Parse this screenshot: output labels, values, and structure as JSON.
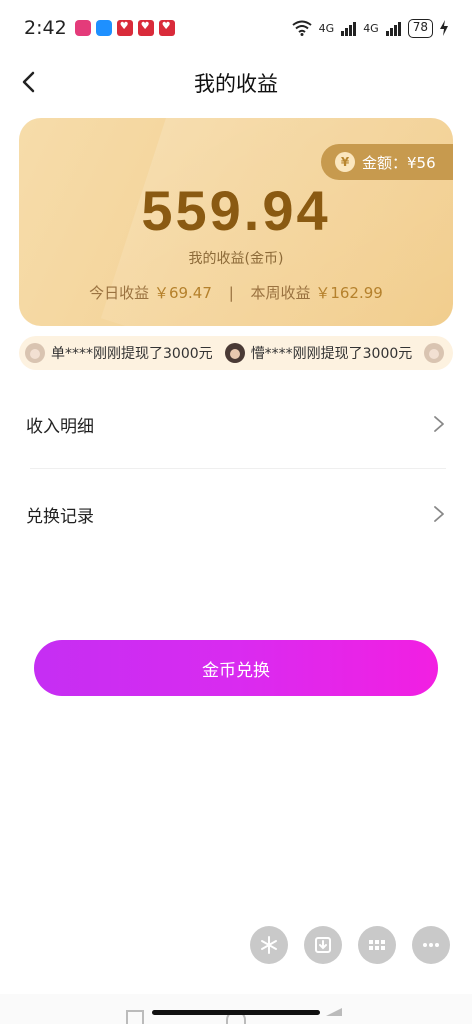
{
  "status_bar": {
    "time": "2:42",
    "network_1": "4G",
    "network_2": "4G",
    "battery": "78"
  },
  "header": {
    "title": "我的收益"
  },
  "card": {
    "amount_label": "金额：¥56",
    "total": "559.94",
    "total_label": "我的收益(金币)",
    "today_label": "今日收益",
    "today_value": "￥69.47",
    "separator": "|",
    "week_label": "本周收益",
    "week_value": "￥162.99"
  },
  "ticker": {
    "items": [
      {
        "text": "单****刚刚提现了3000元"
      },
      {
        "text": "懵****刚刚提现了3000元"
      }
    ]
  },
  "menu": {
    "income_detail": "收入明细",
    "exchange_record": "兑换记录"
  },
  "actions": {
    "exchange_button": "金币兑换"
  },
  "colors": {
    "accent_gradient_start": "#c52ef3",
    "accent_gradient_end": "#f21fe2",
    "card_gold": "#f4d49a",
    "total_text": "#8a5a12"
  }
}
